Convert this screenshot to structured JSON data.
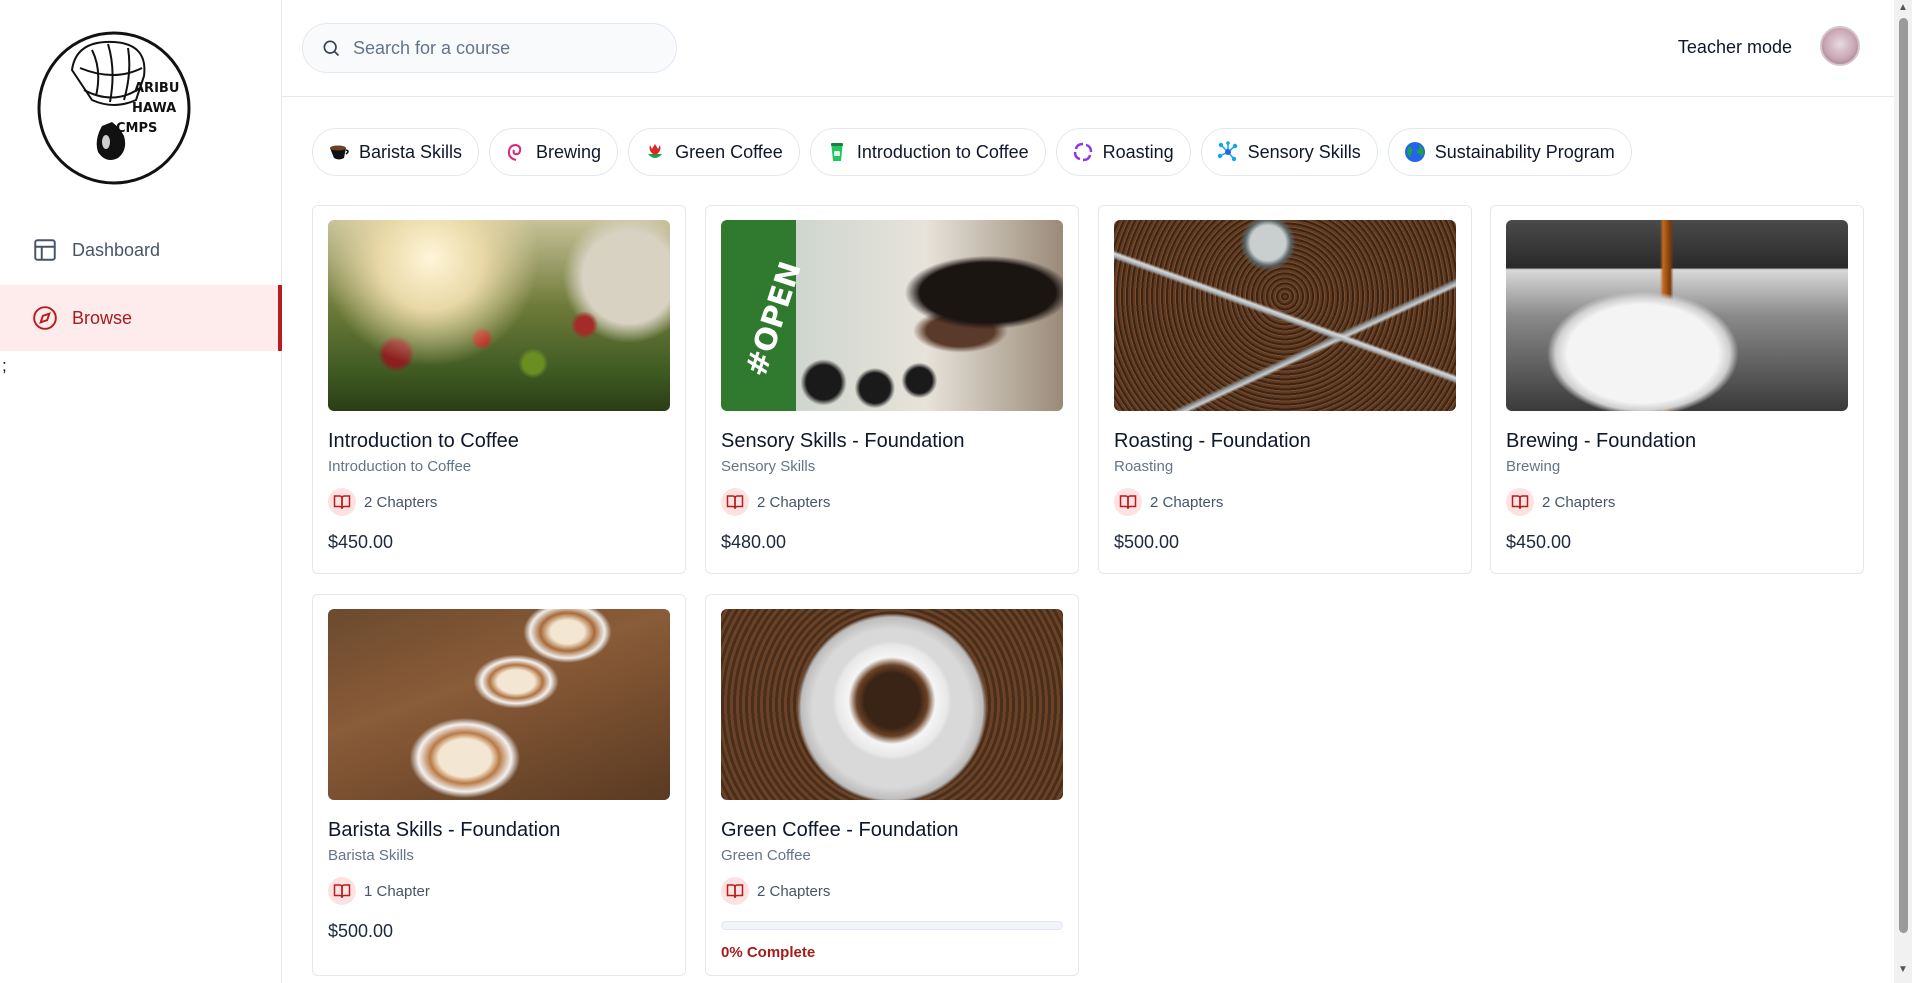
{
  "sidebar": {
    "logo_text": "KARIBU KAHAWA CAMPS",
    "items": [
      {
        "label": "Dashboard",
        "icon": "layout-icon",
        "active": false
      },
      {
        "label": "Browse",
        "icon": "compass-icon",
        "active": true
      }
    ],
    "stray_text": ";"
  },
  "header": {
    "search_placeholder": "Search for a course",
    "teacher_mode_label": "Teacher mode"
  },
  "categories": [
    {
      "label": "Barista Skills",
      "icon": "coffee-cup-icon"
    },
    {
      "label": "Brewing",
      "icon": "swirl-icon"
    },
    {
      "label": "Green Coffee",
      "icon": "flower-icon"
    },
    {
      "label": "Introduction to Coffee",
      "icon": "takeaway-cup-icon"
    },
    {
      "label": "Roasting",
      "icon": "cycle-icon"
    },
    {
      "label": "Sensory Skills",
      "icon": "molecule-icon"
    },
    {
      "label": "Sustainability Program",
      "icon": "globe-icon"
    }
  ],
  "courses": [
    {
      "title": "Introduction to Coffee",
      "category": "Introduction to Coffee",
      "chapters": "2 Chapters",
      "price": "$450.00",
      "image": "coffee-cherries-image"
    },
    {
      "title": "Sensory Skills - Foundation",
      "category": "Sensory Skills",
      "chapters": "2 Chapters",
      "price": "$480.00",
      "image": "coffee-cupping-image",
      "image_text": "#OPEN"
    },
    {
      "title": "Roasting - Foundation",
      "category": "Roasting",
      "chapters": "2 Chapters",
      "price": "$500.00",
      "image": "roaster-drum-image"
    },
    {
      "title": "Brewing - Foundation",
      "category": "Brewing",
      "chapters": "2 Chapters",
      "price": "$450.00",
      "image": "espresso-shot-image"
    },
    {
      "title": "Barista Skills - Foundation",
      "category": "Barista Skills",
      "chapters": "1 Chapter",
      "price": "$500.00",
      "image": "latte-art-image"
    },
    {
      "title": "Green Coffee - Foundation",
      "category": "Green Coffee",
      "chapters": "2 Chapters",
      "progress_percent": 0,
      "progress_label": "0% Complete",
      "image": "coffee-beans-cup-image"
    }
  ],
  "colors": {
    "accent": "#b91c1c",
    "active_bg": "#fdeceb"
  }
}
